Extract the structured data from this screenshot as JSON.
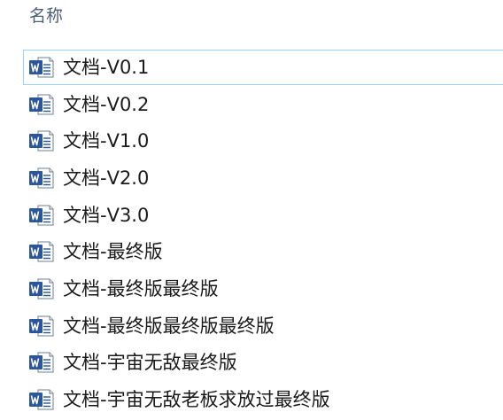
{
  "header": {
    "name_column": "名称"
  },
  "files": [
    {
      "name": "文档-V0.1",
      "icon": "word-doc-icon",
      "selected": true
    },
    {
      "name": "文档-V0.2",
      "icon": "word-doc-icon"
    },
    {
      "name": "文档-V1.0",
      "icon": "word-doc-icon"
    },
    {
      "name": "文档-V2.0",
      "icon": "word-doc-icon"
    },
    {
      "name": "文档-V3.0",
      "icon": "word-doc-icon"
    },
    {
      "name": "文档-最终版",
      "icon": "word-doc-icon"
    },
    {
      "name": "文档-最终版最终版",
      "icon": "word-doc-icon"
    },
    {
      "name": "文档-最终版最终版最终版",
      "icon": "word-doc-icon"
    },
    {
      "name": "文档-宇宙无敌最终版",
      "icon": "word-doc-icon"
    },
    {
      "name": "文档-宇宙无敌老板求放过最终版",
      "icon": "word-doc-icon"
    }
  ],
  "colors": {
    "word_blue": "#2b579a",
    "selection_border": "#99d1ff",
    "header_text": "#4c607a"
  }
}
